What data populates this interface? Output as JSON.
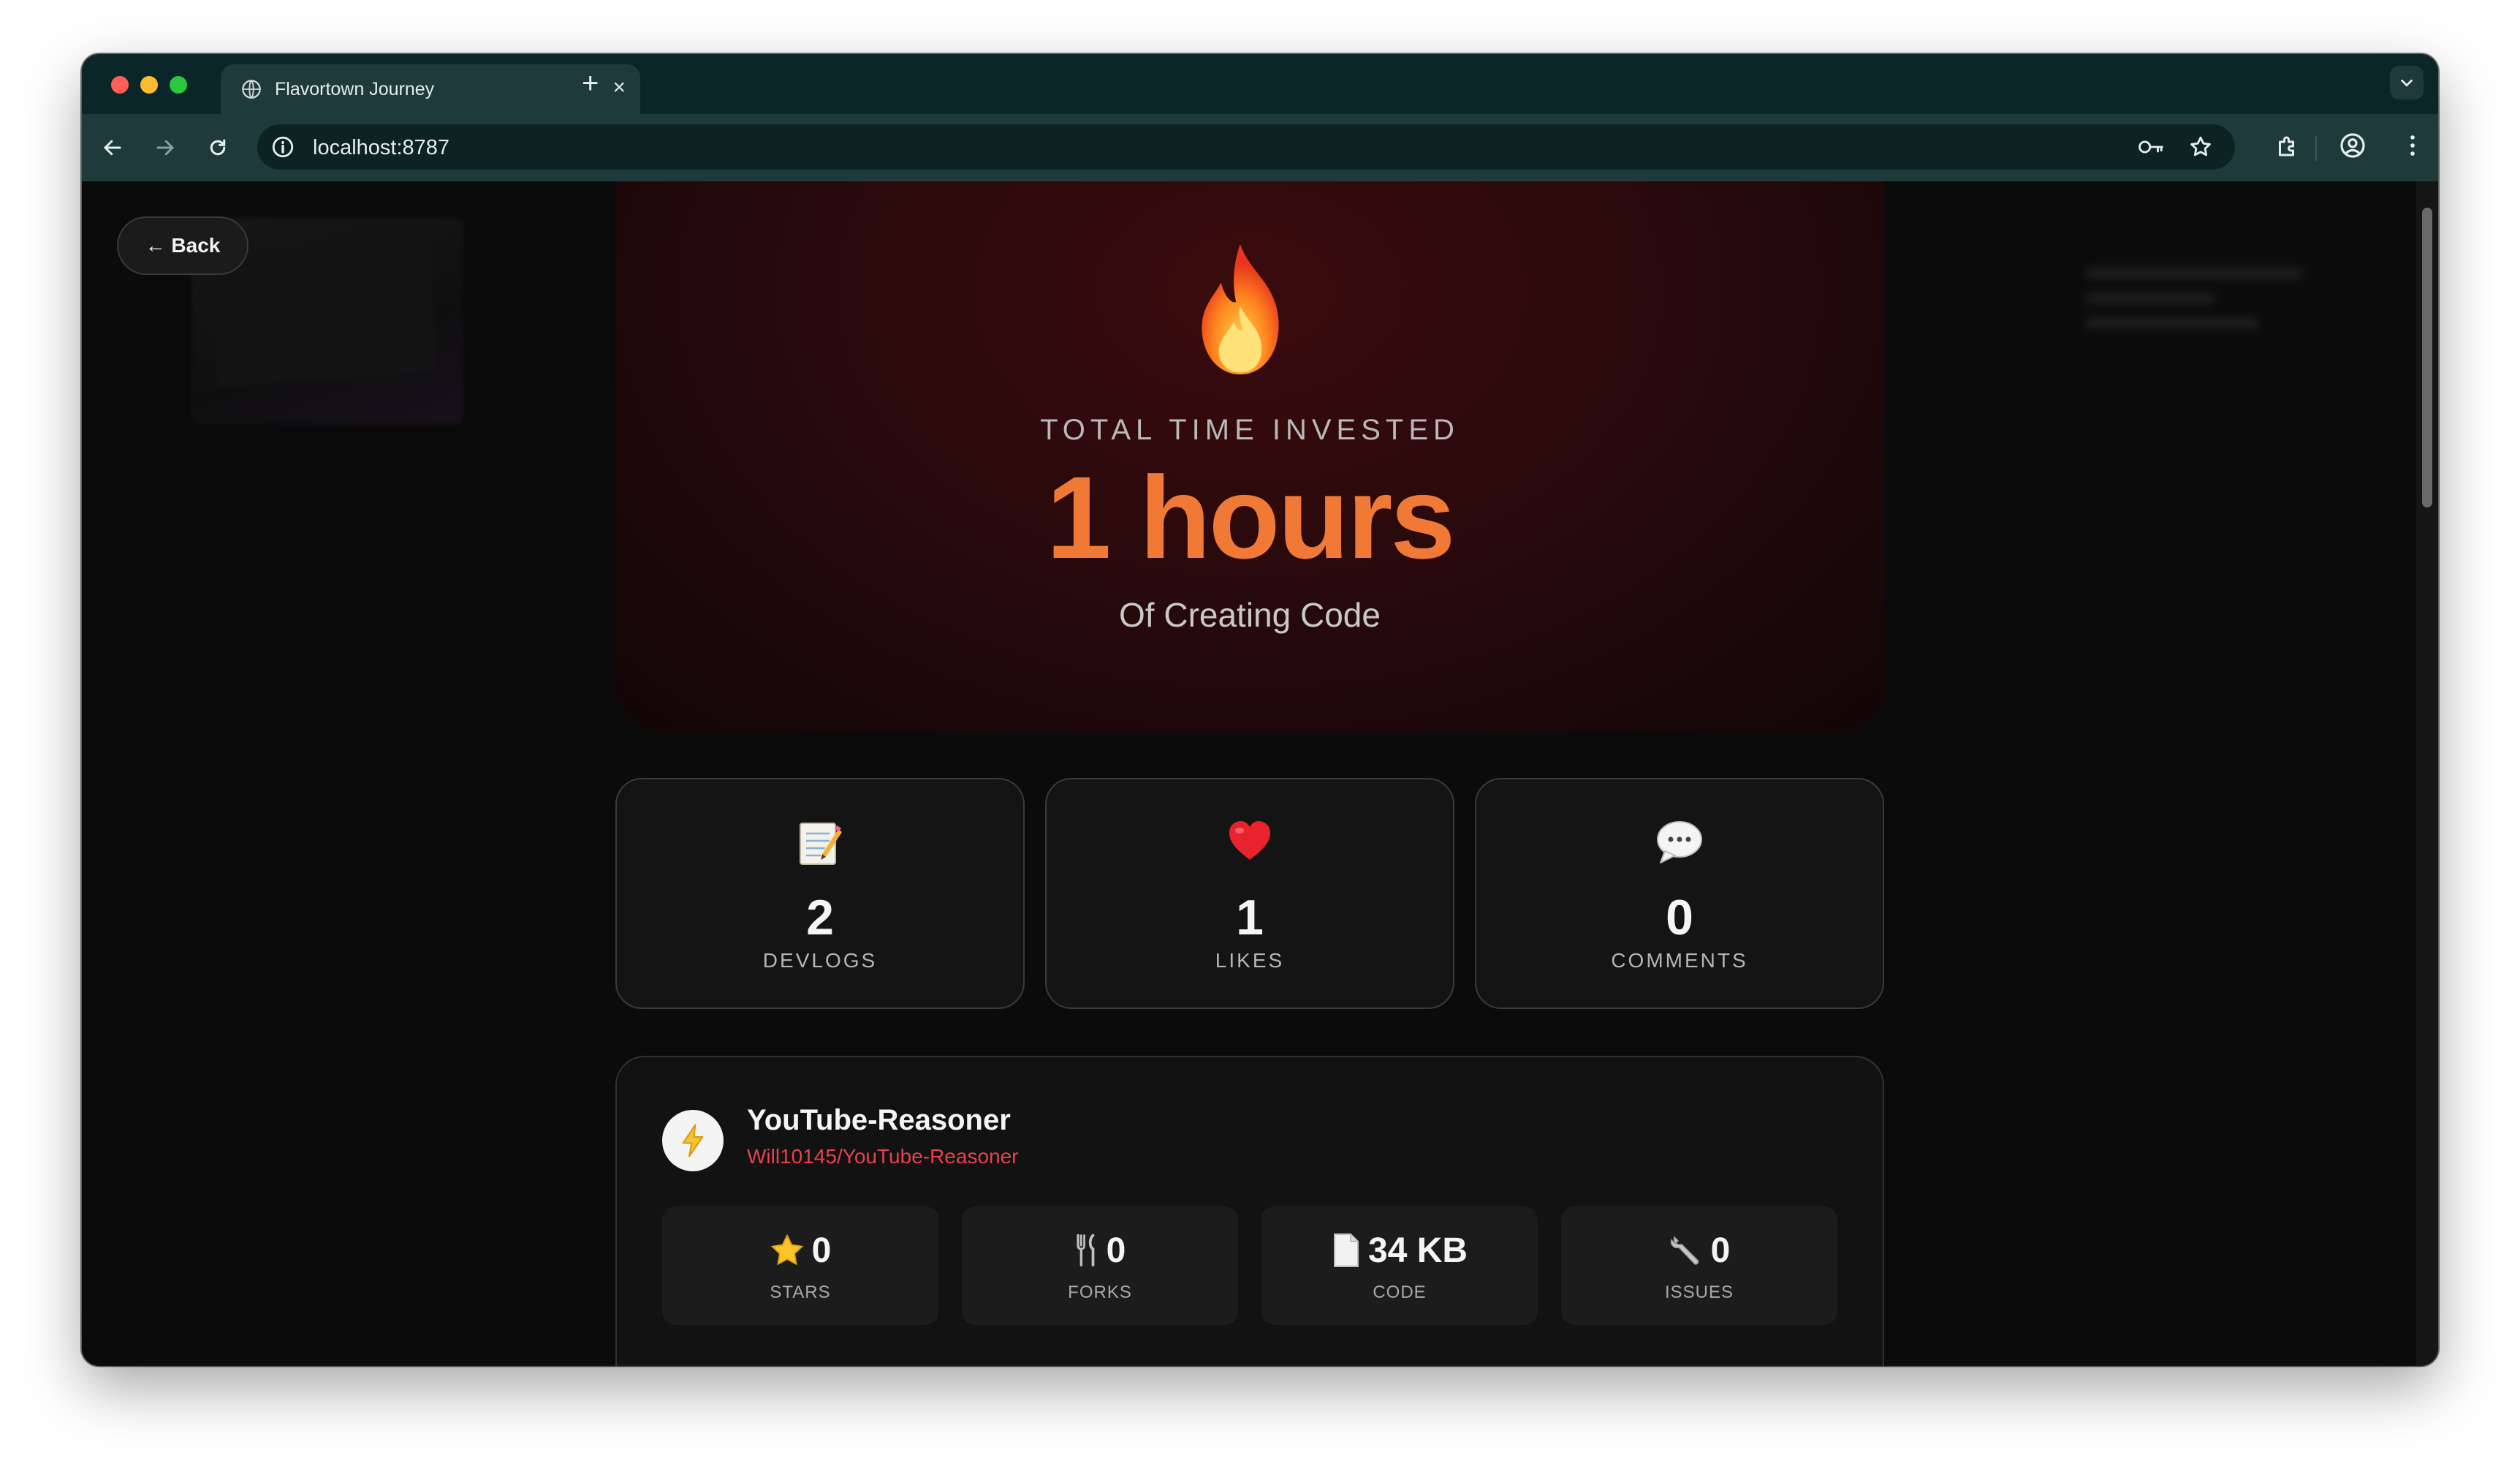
{
  "browser": {
    "tab_title": "Flavortown Journey",
    "url": "localhost:8787",
    "tab_close": "×",
    "new_tab": "+"
  },
  "page": {
    "back_label": "← Back",
    "hero": {
      "kicker": "TOTAL TIME INVESTED",
      "value": "1 hours",
      "subtitle": "Of Creating Code",
      "icon": "fire-icon"
    },
    "stats": [
      {
        "icon": "memo-icon",
        "value": "2",
        "label": "DEVLOGS"
      },
      {
        "icon": "heart-icon",
        "value": "1",
        "label": "LIKES"
      },
      {
        "icon": "speech-bubble-icon",
        "value": "0",
        "label": "COMMENTS"
      }
    ],
    "repo": {
      "icon": "lightning-icon",
      "name": "YouTube-Reasoner",
      "path": "Will10145/YouTube-Reasoner",
      "stats": [
        {
          "icon": "star-icon",
          "value": "0",
          "label": "STARS"
        },
        {
          "icon": "fork-knife-icon",
          "value": "0",
          "label": "FORKS"
        },
        {
          "icon": "document-icon",
          "value": "34 KB",
          "label": "CODE"
        },
        {
          "icon": "wrench-icon",
          "value": "0",
          "label": "ISSUES"
        }
      ]
    }
  },
  "colors": {
    "accent": "#f07a35",
    "link": "#e8414e",
    "tabbar": "#0b2628",
    "toolbar": "#1e3a3a"
  }
}
